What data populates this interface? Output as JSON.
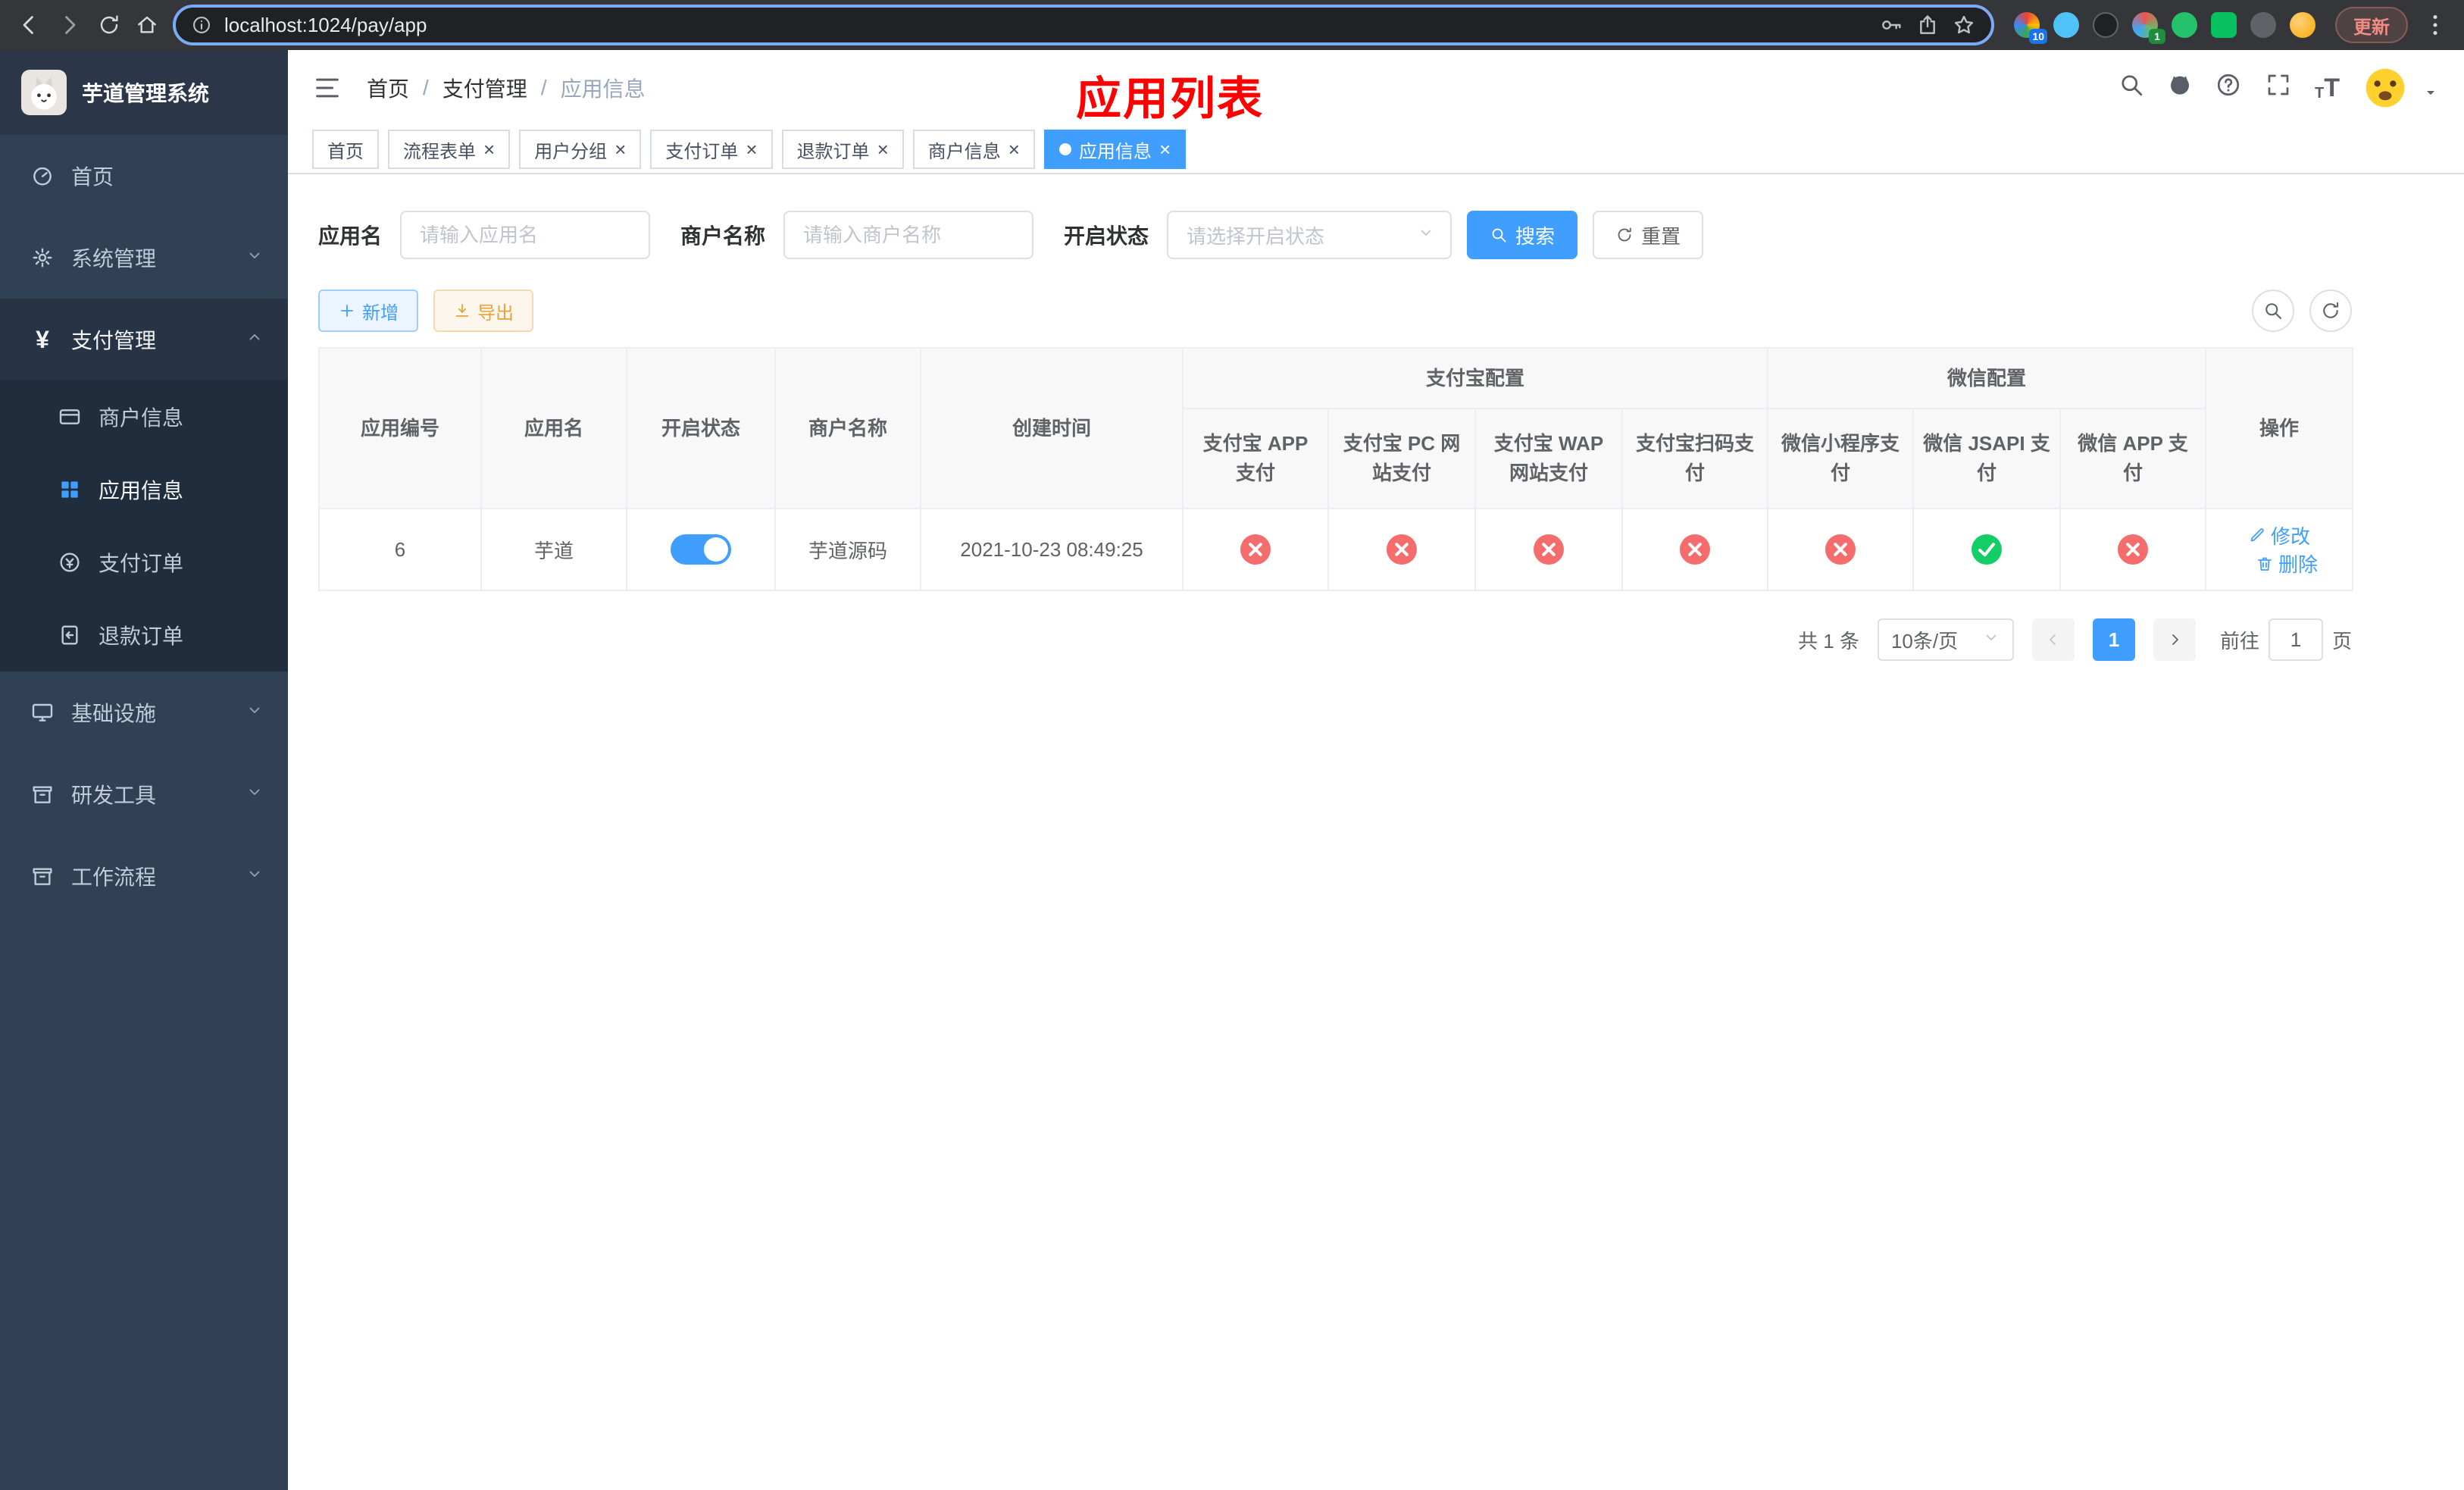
{
  "colors": {
    "accent": "#409eff",
    "danger": "#f56c6c",
    "success": "#13ce66",
    "warning": "#e6a23c",
    "annotation_red": "#ff0000",
    "sidebar_bg": "#304156"
  },
  "browser": {
    "url": "localhost:1024/pay/app",
    "update_label": "更新",
    "extensions": [
      {
        "badge": "10"
      },
      {},
      {},
      {
        "badge": "1"
      },
      {},
      {},
      {},
      {}
    ]
  },
  "sidebar": {
    "title": "芋道管理系统",
    "items": [
      {
        "label": "首页",
        "icon": "dashboard-icon"
      },
      {
        "label": "系统管理",
        "icon": "gear-icon"
      },
      {
        "label": "支付管理",
        "icon": "yen-icon"
      },
      {
        "label": "商户信息",
        "icon": "bank-card-icon"
      },
      {
        "label": "应用信息",
        "icon": "grid-icon"
      },
      {
        "label": "支付订单",
        "icon": "pay-order-icon"
      },
      {
        "label": "退款订单",
        "icon": "refund-order-icon"
      },
      {
        "label": "基础设施",
        "icon": "monitor-icon"
      },
      {
        "label": "研发工具",
        "icon": "toolbox-icon"
      },
      {
        "label": "工作流程",
        "icon": "workflow-icon"
      }
    ]
  },
  "header": {
    "breadcrumb": [
      "首页",
      "支付管理",
      "应用信息"
    ],
    "annotation": "应用列表"
  },
  "tabs": [
    {
      "label": "首页"
    },
    {
      "label": "流程表单"
    },
    {
      "label": "用户分组"
    },
    {
      "label": "支付订单"
    },
    {
      "label": "退款订单"
    },
    {
      "label": "商户信息"
    },
    {
      "label": "应用信息"
    }
  ],
  "filters": {
    "app_name_label": "应用名",
    "app_name_placeholder": "请输入应用名",
    "merchant_label": "商户名称",
    "merchant_placeholder": "请输入商户名称",
    "status_label": "开启状态",
    "status_placeholder": "请选择开启状态",
    "search_label": "搜索",
    "reset_label": "重置"
  },
  "toolbar": {
    "add_label": "新增",
    "export_label": "导出"
  },
  "table": {
    "group_headers": {
      "alipay": "支付宝配置",
      "wechat": "微信配置"
    },
    "columns": {
      "id": "应用编号",
      "name": "应用名",
      "status": "开启状态",
      "merchant": "商户名称",
      "created": "创建时间",
      "alipay_app": "支付宝 APP 支付",
      "alipay_pc": "支付宝 PC 网站支付",
      "alipay_wap": "支付宝 WAP 网站支付",
      "alipay_qr": "支付宝扫码支付",
      "wx_mini": "微信小程序支付",
      "wx_jsapi": "微信 JSAPI 支付",
      "wx_app": "微信 APP 支付",
      "actions": "操作"
    },
    "rows": [
      {
        "id": "6",
        "name": "芋道",
        "enabled": true,
        "merchant": "芋道源码",
        "created": "2021-10-23 08:49:25",
        "alipay_app": false,
        "alipay_pc": false,
        "alipay_wap": false,
        "alipay_qr": false,
        "wx_mini": false,
        "wx_jsapi": true,
        "wx_app": false,
        "edit_label": "修改",
        "delete_label": "删除"
      }
    ]
  },
  "pagination": {
    "total": "共 1 条",
    "page_size": "10条/页",
    "page": "1",
    "goto_label": "前往",
    "goto_value": "1",
    "goto_unit": "页"
  }
}
